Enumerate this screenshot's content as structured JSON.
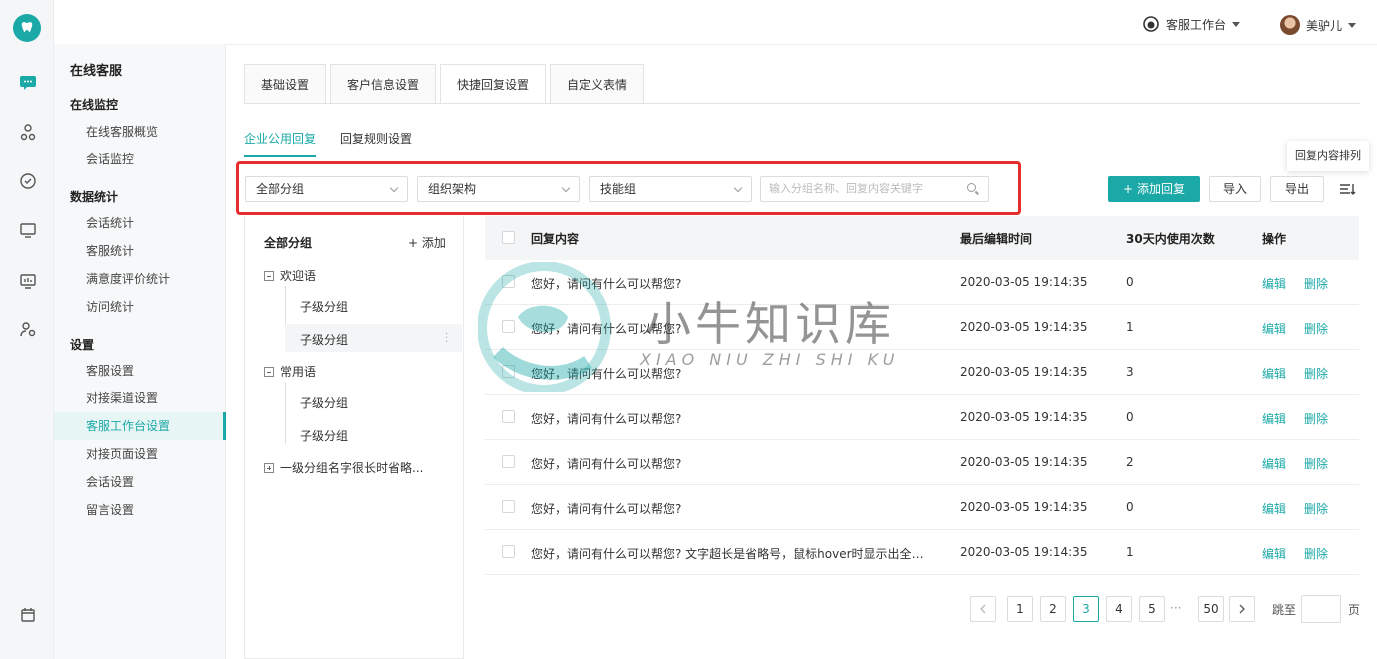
{
  "header": {
    "workbench_label": "客服工作台",
    "user_name": "美驴儿"
  },
  "subnav": {
    "title": "在线客服",
    "groups": [
      {
        "heading": "在线监控",
        "items": [
          "在线客服概览",
          "会话监控"
        ]
      },
      {
        "heading": "数据统计",
        "items": [
          "会话统计",
          "客服统计",
          "满意度评价统计",
          "访问统计"
        ]
      },
      {
        "heading": "设置",
        "items": [
          "客服设置",
          "对接渠道设置",
          "客服工作台设置",
          "对接页面设置",
          "会话设置",
          "留言设置"
        ]
      }
    ],
    "active_item": "客服工作台设置"
  },
  "top_tabs": [
    "基础设置",
    "客户信息设置",
    "快捷回复设置",
    "自定义表情"
  ],
  "sub_tabs": [
    "企业公用回复",
    "回复规则设置"
  ],
  "filters": {
    "group_select": "全部分组",
    "org_select": "组织架构",
    "skill_select": "技能组",
    "search_placeholder": "输入分组名称、回复内容关键字"
  },
  "actions": {
    "add_label": "添加回复",
    "add_icon": "+",
    "import_label": "导入",
    "export_label": "导出",
    "tooltip": "回复内容排列"
  },
  "tree": {
    "heading": "全部分组",
    "add_label": "+ 添加",
    "nodes": [
      {
        "label": "欢迎语",
        "children": [
          "子级分组",
          "子级分组"
        ]
      },
      {
        "label": "常用语",
        "children": [
          "子级分组",
          "子级分组"
        ]
      },
      {
        "label": "一级分组名字很长时省略...",
        "children": []
      }
    ]
  },
  "table": {
    "columns": [
      "回复内容",
      "最后编辑时间",
      "30天内使用次数",
      "操作"
    ],
    "rows": [
      {
        "content": "您好，请问有什么可以帮您?",
        "time": "2020-03-05 19:14:35",
        "count": "0",
        "edit": "编辑",
        "delete": "删除"
      },
      {
        "content": "您好，请问有什么可以帮您?",
        "time": "2020-03-05 19:14:35",
        "count": "1",
        "edit": "编辑",
        "delete": "删除"
      },
      {
        "content": "您好，请问有什么可以帮您?",
        "time": "2020-03-05 19:14:35",
        "count": "3",
        "edit": "编辑",
        "delete": "删除"
      },
      {
        "content": "您好，请问有什么可以帮您?",
        "time": "2020-03-05 19:14:35",
        "count": "0",
        "edit": "编辑",
        "delete": "删除"
      },
      {
        "content": "您好，请问有什么可以帮您?",
        "time": "2020-03-05 19:14:35",
        "count": "2",
        "edit": "编辑",
        "delete": "删除"
      },
      {
        "content": "您好，请问有什么可以帮您?",
        "time": "2020-03-05 19:14:35",
        "count": "0",
        "edit": "编辑",
        "delete": "删除"
      },
      {
        "content": "您好，请问有什么可以帮您? 文字超长是省略号，鼠标hover时显示出全部...",
        "time": "2020-03-05 19:14:35",
        "count": "1",
        "edit": "编辑",
        "delete": "删除"
      }
    ]
  },
  "pagination": {
    "pages": [
      "1",
      "2",
      "3",
      "4",
      "5"
    ],
    "current": "3",
    "ellipsis": "···",
    "last": "50",
    "jump_label": "跳至",
    "page_suffix": "页"
  },
  "watermark": {
    "cn": "小牛知识库",
    "en": "XIAO NIU ZHI SHI KU"
  },
  "colors": {
    "accent": "#1ba9a7",
    "highlight_box": "#e62c2c"
  }
}
